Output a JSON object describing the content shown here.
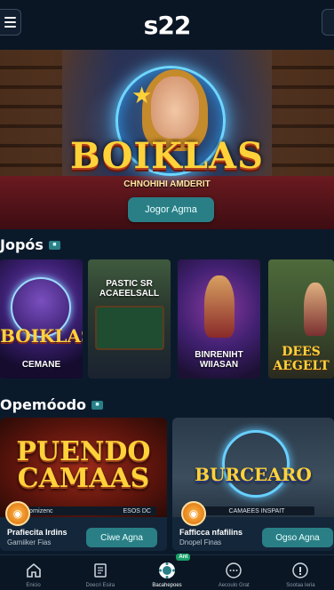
{
  "header": {
    "logo": "s22"
  },
  "hero": {
    "game_title": "BOIKLAS",
    "game_subtitle": "CHNOHIHI AMDERIT",
    "cta_label": "Jogor Agma"
  },
  "sections": {
    "games_title": "Jopós",
    "promo_title": "Opemóodo"
  },
  "games": [
    {
      "title": "BOIKLAS",
      "label": "CEMANE"
    },
    {
      "title": "",
      "label": "PASTIC SR ACAEELSALL"
    },
    {
      "title": "",
      "label": "BINRENIHT WIIASAN"
    },
    {
      "title": "DEES AEGELT",
      "label": ""
    }
  ],
  "promos": [
    {
      "title": "PUENDO CAMAAS",
      "strip_left": "Dornizenc",
      "strip_right": "ESOS DC",
      "line1": "Prafiecita Irdins",
      "line2": "Gamiiker Fias",
      "cta_label": "Ciwe Agna"
    },
    {
      "title": "BURCEARO",
      "strip_center": "CAMAEES INSPAIT",
      "line1": "Fafficca nfafilins",
      "line2": "Dnopel Finas",
      "cta_label": "Ogso Agna"
    }
  ],
  "bottom_nav": [
    {
      "label": "Enicio",
      "icon": "home-icon"
    },
    {
      "label": "Doecri Esira",
      "icon": "receipt-icon"
    },
    {
      "label": "Bacahepoes",
      "icon": "chip-icon",
      "badge": "Ant"
    },
    {
      "label": "Aecoulo Grat",
      "icon": "chat-icon"
    },
    {
      "label": "Sootaa Ieria",
      "icon": "support-icon"
    }
  ],
  "colors": {
    "background": "#0b1a2b",
    "accent": "#2a7f86",
    "gold": "#ffd23a"
  }
}
